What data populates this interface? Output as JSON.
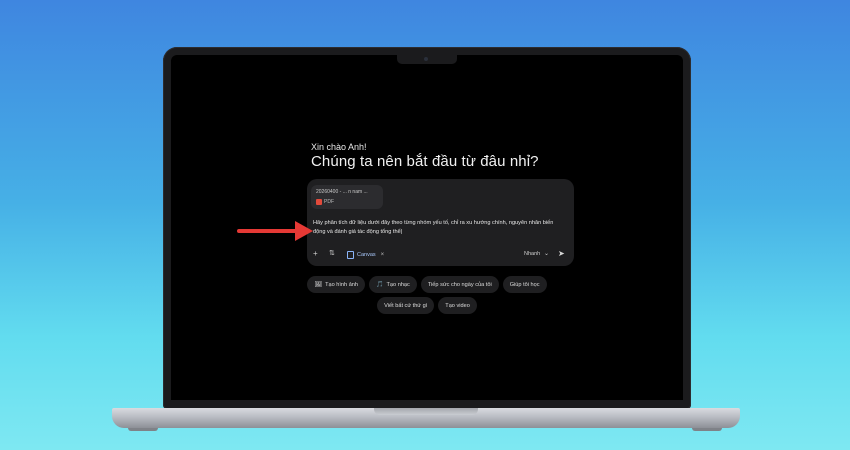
{
  "header": {
    "greeting": "Xin chào Anh!",
    "headline": "Chúng ta nên bắt đầu từ đâu nhỉ?"
  },
  "attachment": {
    "file_name": "20260400 - ... n nam ...",
    "file_type": "PDF"
  },
  "prompt": {
    "text": "Hãy phân tích dữ liệu dưới đây theo từng nhóm yếu tố, chỉ ra xu hướng chính, nguyên nhân biến động và đánh giá tác động tổng thể|"
  },
  "toolbar": {
    "add_icon": "plus-icon",
    "tools_icon": "tune-icon",
    "canvas_label": "Canvas",
    "canvas_close": "×",
    "mode_label": "Nhanh",
    "mode_caret": "⌄",
    "send_icon": "send-icon",
    "add_glyph": "+",
    "tools_glyph": "⇅",
    "send_glyph": "➤"
  },
  "suggestions": {
    "row1": [
      {
        "icon": "image-icon",
        "glyph": "🖼",
        "label": "Tạo hình ảnh"
      },
      {
        "icon": "music-icon",
        "glyph": "🎵",
        "label": "Tạo nhạc"
      },
      {
        "icon": "",
        "glyph": "",
        "label": "Tiếp sức cho ngày của tôi"
      },
      {
        "icon": "",
        "glyph": "",
        "label": "Giúp tôi học"
      }
    ],
    "row2": [
      {
        "icon": "",
        "glyph": "",
        "label": "Viết bất cứ thứ gì"
      },
      {
        "icon": "",
        "glyph": "",
        "label": "Tạo video"
      }
    ]
  },
  "colors": {
    "accent_arrow": "#e53935",
    "canvas_accent": "#a8c7fa",
    "panel_bg": "#1f1f21"
  }
}
